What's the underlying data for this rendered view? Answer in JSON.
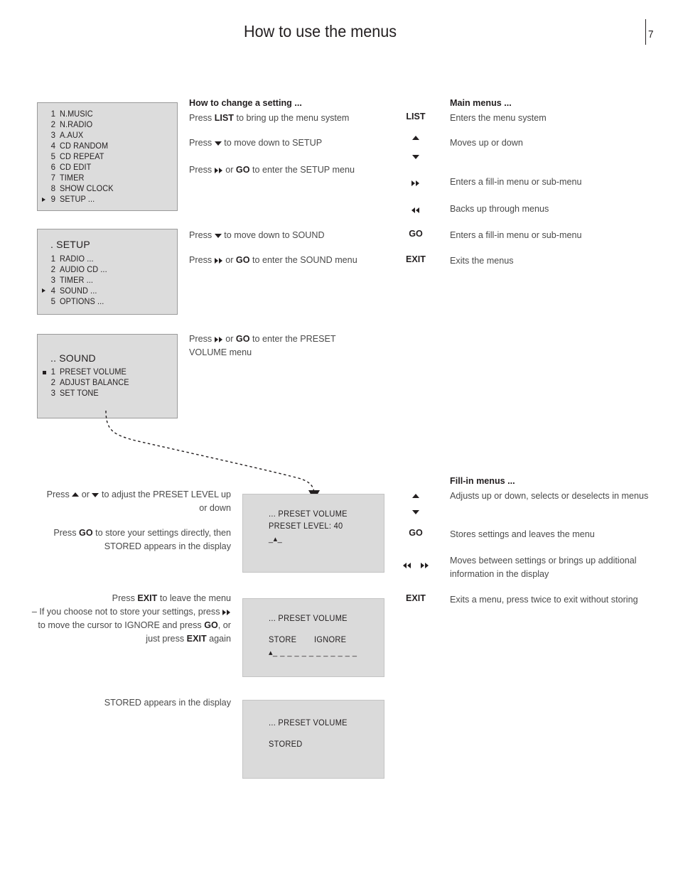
{
  "header": {
    "title": "How to use the menus",
    "page_number": "7"
  },
  "menu_screens": {
    "main": {
      "items": [
        {
          "num": "1",
          "label": "N.MUSIC",
          "marker": "none"
        },
        {
          "num": "2",
          "label": "N.RADIO",
          "marker": "none"
        },
        {
          "num": "3",
          "label": "A.AUX",
          "marker": "none"
        },
        {
          "num": "4",
          "label": "CD RANDOM",
          "marker": "none"
        },
        {
          "num": "5",
          "label": "CD REPEAT",
          "marker": "none"
        },
        {
          "num": "6",
          "label": "CD EDIT",
          "marker": "none"
        },
        {
          "num": "7",
          "label": "TIMER",
          "marker": "none"
        },
        {
          "num": "8",
          "label": "SHOW CLOCK",
          "marker": "none"
        },
        {
          "num": "9",
          "label": "SETUP ...",
          "marker": "triangle"
        }
      ]
    },
    "setup": {
      "heading": ". SETUP",
      "items": [
        {
          "num": "1",
          "label": "RADIO ...",
          "marker": "none"
        },
        {
          "num": "2",
          "label": "AUDIO CD ...",
          "marker": "none"
        },
        {
          "num": "3",
          "label": "TIMER ...",
          "marker": "none"
        },
        {
          "num": "4",
          "label": "SOUND ...",
          "marker": "triangle"
        },
        {
          "num": "5",
          "label": "OPTIONS ...",
          "marker": "none"
        }
      ]
    },
    "sound": {
      "heading": ".. SOUND",
      "items": [
        {
          "num": "1",
          "label": "PRESET VOLUME",
          "marker": "square"
        },
        {
          "num": "2",
          "label": "ADJUST BALANCE",
          "marker": "none"
        },
        {
          "num": "3",
          "label": "SET TONE",
          "marker": "none"
        }
      ]
    }
  },
  "displays": {
    "preset_volume_level": {
      "title": "... PRESET VOLUME",
      "line2": "PRESET LEVEL:   40",
      "cursor": "_▴_"
    },
    "store_ignore": {
      "title": "... PRESET VOLUME",
      "option_store": "STORE",
      "option_ignore": "IGNORE",
      "cursor": "▴_ _ _ _ _ _ _ _ _ _ _ _"
    },
    "stored": {
      "title": "... PRESET VOLUME",
      "line2": "STORED"
    }
  },
  "instructions": {
    "section_heading": "How to change a setting ...",
    "step1_pre": "Press ",
    "step1_key": "LIST",
    "step1_post": " to bring up the menu system",
    "step2_pre": "Press ",
    "step2_post": " to move down to SETUP",
    "step3_pre": "Press ",
    "step3_mid": " or ",
    "step3_key": "GO",
    "step3_post": " to enter the SETUP menu",
    "step4_pre": "Press ",
    "step4_post": " to move down to SOUND",
    "step5_pre": "Press ",
    "step5_mid": " or ",
    "step5_key": "GO",
    "step5_post": " to enter the SOUND menu",
    "step6_pre": "Press ",
    "step6_mid": " or ",
    "step6_key": "GO",
    "step6_post": " to enter the PRESET VOLUME menu"
  },
  "instructions_lower": {
    "adjust_pre": "Press ",
    "adjust_mid": " or ",
    "adjust_post": " to adjust the PRESET LEVEL up or down",
    "store_pre": "Press ",
    "store_key": "GO",
    "store_post": " to store your settings directly, then STORED appears in the display",
    "exit_pre": "Press ",
    "exit_key": "EXIT",
    "exit_post": " to leave the menu",
    "ignore_pre": "– If you choose not to store your settings, press ",
    "ignore_mid": " to move the cursor to IGNORE and press ",
    "ignore_key": "GO",
    "ignore_post": ", or just press ",
    "ignore_key2": "EXIT",
    "ignore_end": " again",
    "stored_note": "STORED appears in the display"
  },
  "legend_main": {
    "heading": "Main menus ...",
    "rows": [
      {
        "key": "LIST",
        "glyph": "none",
        "desc": "Enters the menu system"
      },
      {
        "key": "",
        "glyph": "up-down",
        "desc": "Moves up or down"
      },
      {
        "key": "",
        "glyph": "forward",
        "desc": "Enters a fill-in menu or sub-menu"
      },
      {
        "key": "",
        "glyph": "back",
        "desc": "Backs up through menus"
      },
      {
        "key": "GO",
        "glyph": "none",
        "desc": "Enters a fill-in menu or sub-menu"
      },
      {
        "key": "EXIT",
        "glyph": "none",
        "desc": "Exits the menus"
      }
    ]
  },
  "legend_fillin": {
    "heading": "Fill-in menus ...",
    "rows": [
      {
        "key": "",
        "glyph": "up-down",
        "desc": "Adjusts up or down, selects or deselects in menus"
      },
      {
        "key": "GO",
        "glyph": "none",
        "desc": "Stores settings and leaves the menu"
      },
      {
        "key": "",
        "glyph": "back-forward",
        "desc": "Moves between settings or brings up additional information in the display"
      },
      {
        "key": "EXIT",
        "glyph": "none",
        "desc": "Exits a menu, press twice to exit without storing"
      }
    ]
  }
}
